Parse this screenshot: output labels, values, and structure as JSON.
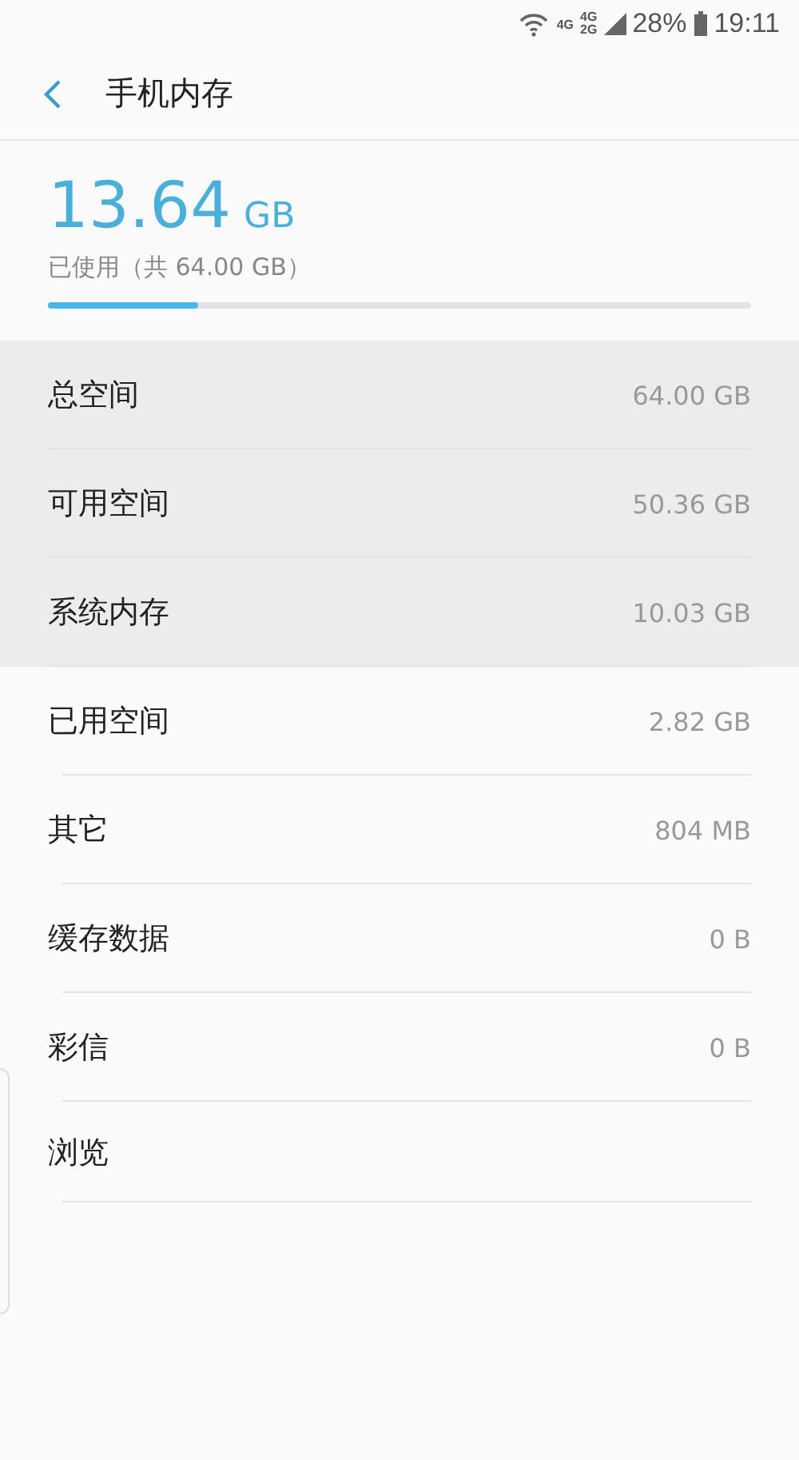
{
  "status_bar": {
    "network_1": "4G",
    "network_2_top": "4G",
    "network_2_bottom": "2G",
    "battery": "28%",
    "time": "19:11"
  },
  "header": {
    "title": "手机内存"
  },
  "usage": {
    "amount": "13.64",
    "unit": "GB",
    "caption": "已使用（共 64.00 GB）",
    "level": 0.213
  },
  "rows": [
    {
      "label": "总空间",
      "value": "64.00 GB",
      "shaded": true
    },
    {
      "label": "可用空间",
      "value": "50.36 GB",
      "shaded": true
    },
    {
      "label": "系统内存",
      "value": "10.03 GB",
      "shaded": true
    },
    {
      "label": "已用空间",
      "value": "2.82 GB",
      "shaded": false
    },
    {
      "label": "其它",
      "value": "804 MB",
      "shaded": false
    },
    {
      "label": "缓存数据",
      "value": "0 B",
      "shaded": false
    },
    {
      "label": "彩信",
      "value": "0 B",
      "shaded": false
    },
    {
      "label": "浏览",
      "shaded": false
    }
  ]
}
